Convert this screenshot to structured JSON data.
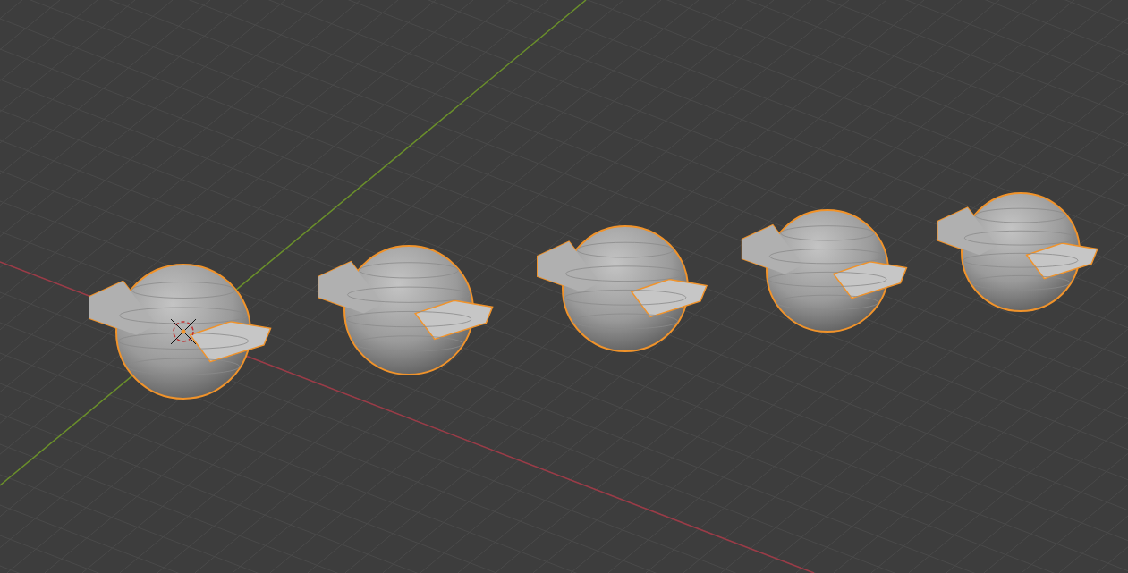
{
  "viewport": {
    "objects": [
      {
        "selected": true
      },
      {
        "selected": true
      },
      {
        "selected": true
      },
      {
        "selected": true
      },
      {
        "selected": true
      }
    ],
    "cursor_visible": true
  }
}
